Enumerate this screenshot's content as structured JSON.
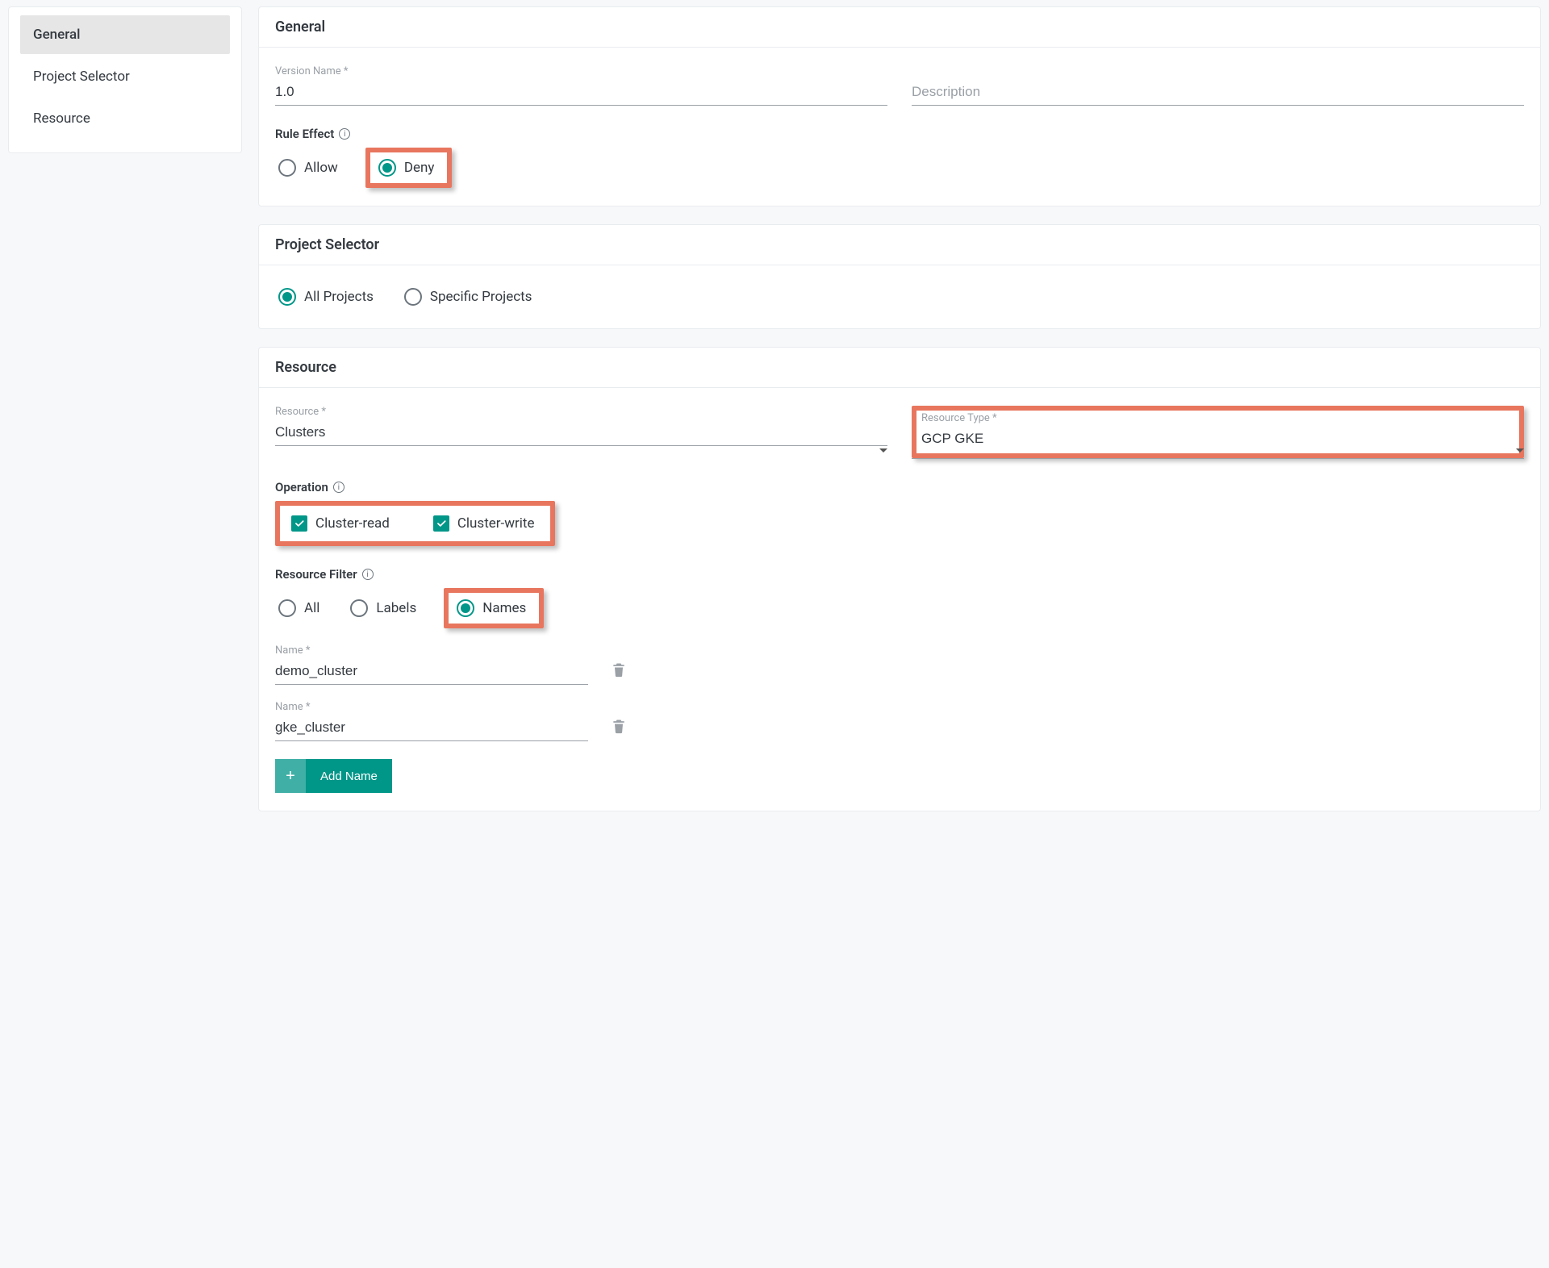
{
  "sidebar": {
    "items": [
      {
        "label": "General",
        "active": true
      },
      {
        "label": "Project Selector",
        "active": false
      },
      {
        "label": "Resource",
        "active": false
      }
    ]
  },
  "general": {
    "title": "General",
    "version_label": "Version Name *",
    "version_value": "1.0",
    "description_placeholder": "Description",
    "rule_effect_label": "Rule Effect",
    "allow_label": "Allow",
    "deny_label": "Deny",
    "selected_effect": "Deny"
  },
  "project_selector": {
    "title": "Project Selector",
    "all_label": "All Projects",
    "specific_label": "Specific Projects",
    "selected": "All Projects"
  },
  "resource": {
    "title": "Resource",
    "resource_field_label": "Resource *",
    "resource_value": "Clusters",
    "resource_type_label": "Resource Type *",
    "resource_type_value": "GCP GKE",
    "operation_label": "Operation",
    "op_read_label": "Cluster-read",
    "op_write_label": "Cluster-write",
    "op_read_checked": true,
    "op_write_checked": true,
    "filter_label": "Resource Filter",
    "filter_all": "All",
    "filter_labels": "Labels",
    "filter_names": "Names",
    "filter_selected": "Names",
    "name_label": "Name *",
    "names": [
      {
        "value": "demo_cluster"
      },
      {
        "value": "gke_cluster"
      }
    ],
    "add_name_label": "Add Name"
  }
}
